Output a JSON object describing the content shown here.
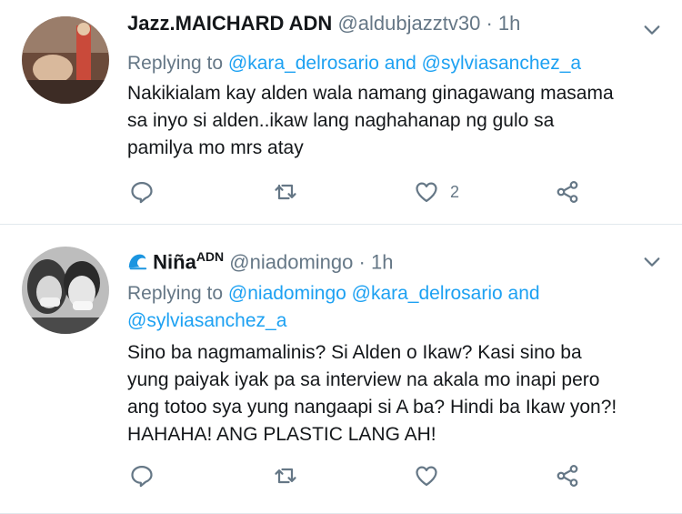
{
  "tweets": [
    {
      "name": "Jazz.MAICHARD ADN",
      "handle": "@aldubjazztv30",
      "dot": "·",
      "time": "1h",
      "reply_prefix": "Replying to",
      "reply_link": "@kara_delrosario and @sylviasanchez_a",
      "text_lines": [
        "Nakikialam kay alden wala namang ginagawang masama",
        "sa inyo si alden..ikaw lang naghahanap ng gulo sa",
        "pamilya mo mrs atay"
      ],
      "likes": "2"
    },
    {
      "name": "Niña",
      "name_sup": "ADN",
      "handle": "@niadomingo",
      "dot": "·",
      "time": "1h",
      "reply_prefix": "Replying to",
      "reply_link_line1": "@niadomingo @kara_delrosario and",
      "reply_link_line2": "@sylviasanchez_a",
      "text_lines": [
        "Sino ba nagmamalinis? Si Alden o Ikaw? Kasi sino ba",
        "yung paiyak iyak pa sa interview na akala mo inapi pero",
        "ang totoo sya yung nangaapi si A ba? Hindi ba Ikaw yon?!",
        "HAHAHA! ANG PLASTIC LANG AH!"
      ],
      "likes": ""
    }
  ],
  "icons": [
    "reply-icon",
    "retweet-icon",
    "like-icon",
    "share-icon",
    "chevron-down-icon",
    "wave-emoji-icon"
  ],
  "colors": {
    "link": "#1da1f2",
    "muted": "#657786",
    "text": "#14171a",
    "divider": "#e1e8ed"
  }
}
